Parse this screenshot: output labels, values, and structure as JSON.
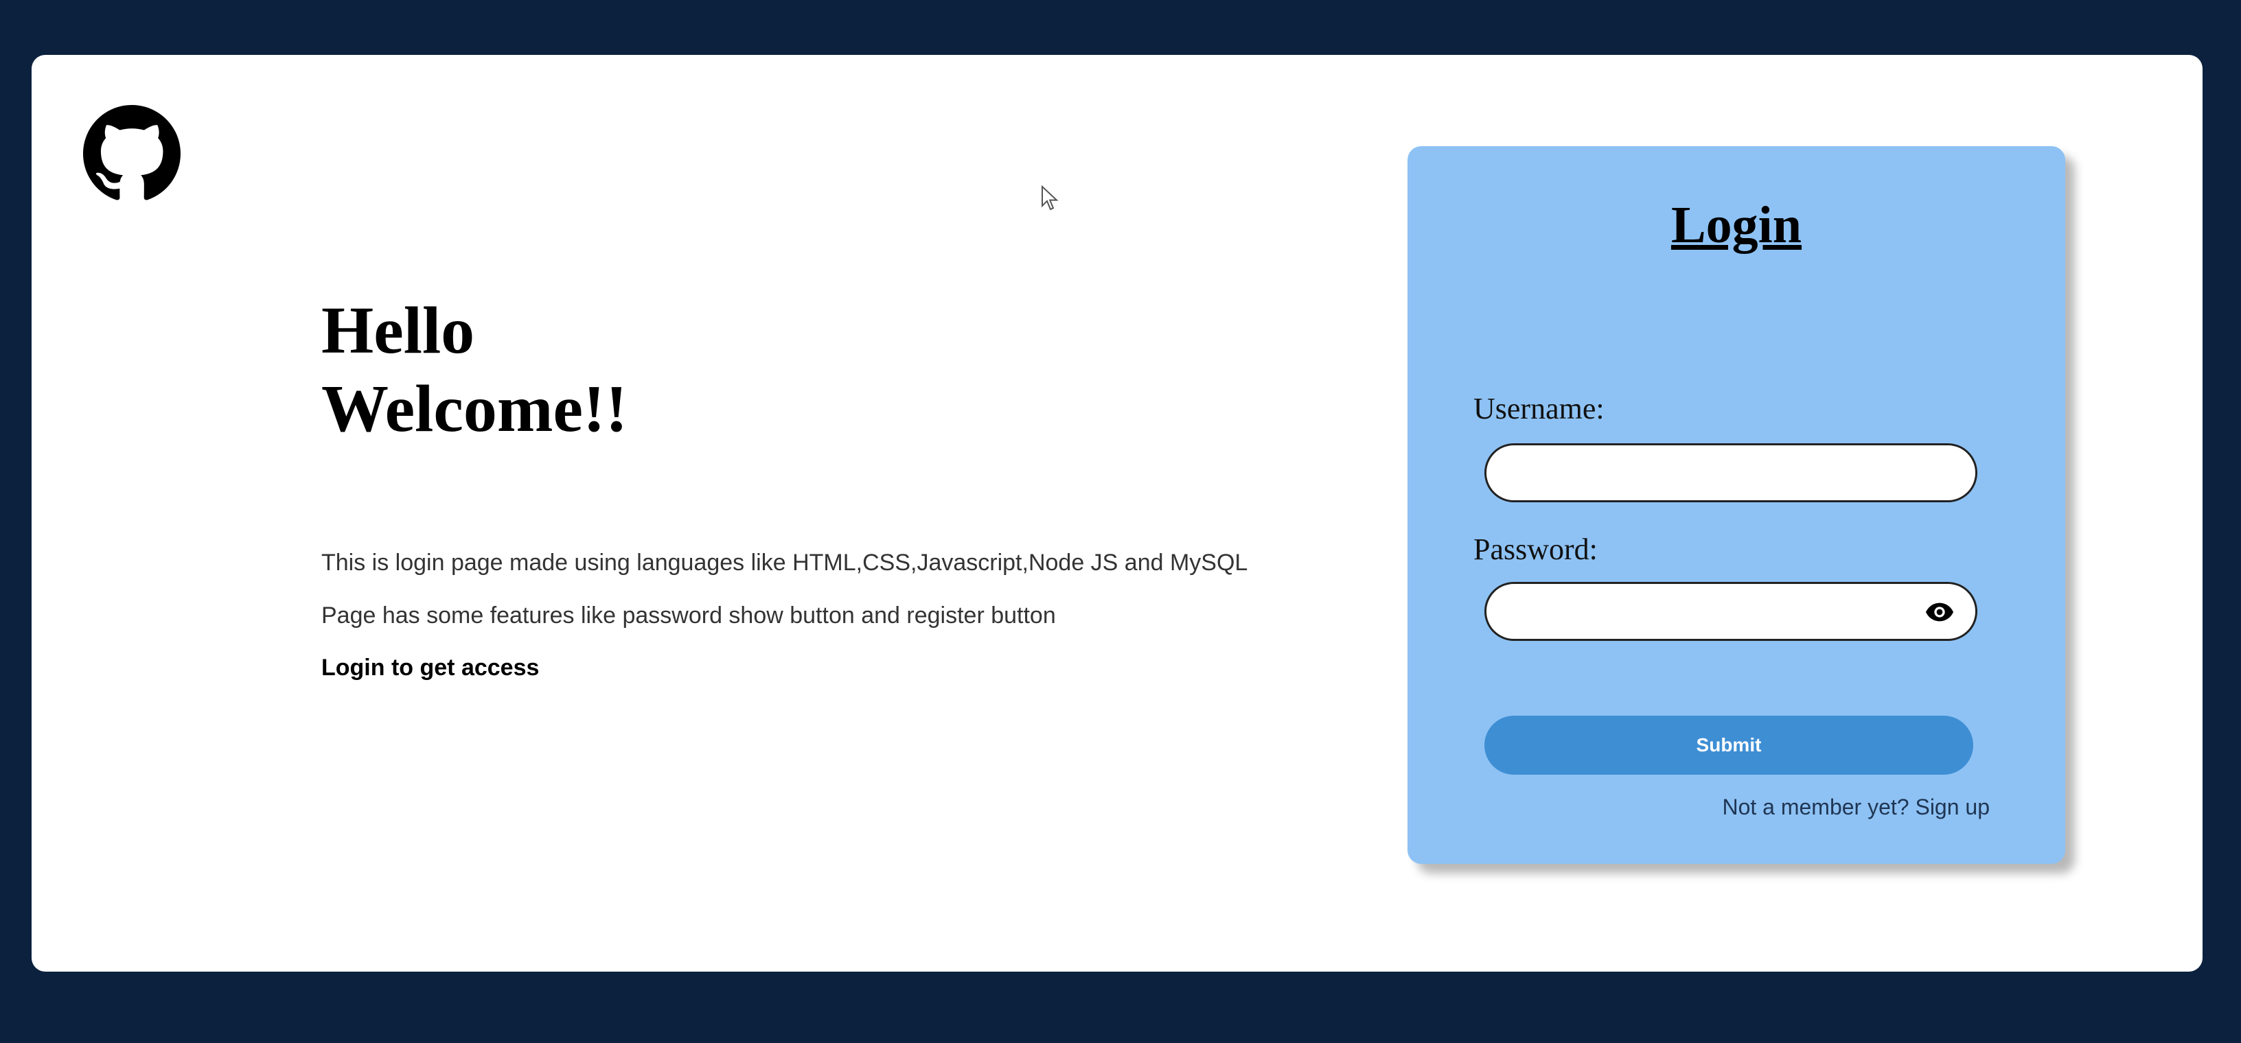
{
  "brand": {
    "logo_icon": "github-icon"
  },
  "hero": {
    "line1": "Hello",
    "line2": "Welcome!!"
  },
  "description": {
    "line1": "This is login page made using languages like HTML,CSS,Javascript,Node JS and MySQL",
    "line2": "Page has some features like password show button and register button",
    "line3": "Login to get access"
  },
  "login": {
    "title": "Login",
    "username_label": "Username:",
    "username_value": "",
    "password_label": "Password:",
    "password_value": "",
    "show_password_icon": "eye-icon",
    "submit_label": "Submit",
    "signup_text": "Not a member yet? Sign up"
  },
  "colors": {
    "page_background": "#0c213e",
    "card_background": "#ffffff",
    "panel_background": "#8ec2f4",
    "submit_button": "#3e8ed4"
  }
}
